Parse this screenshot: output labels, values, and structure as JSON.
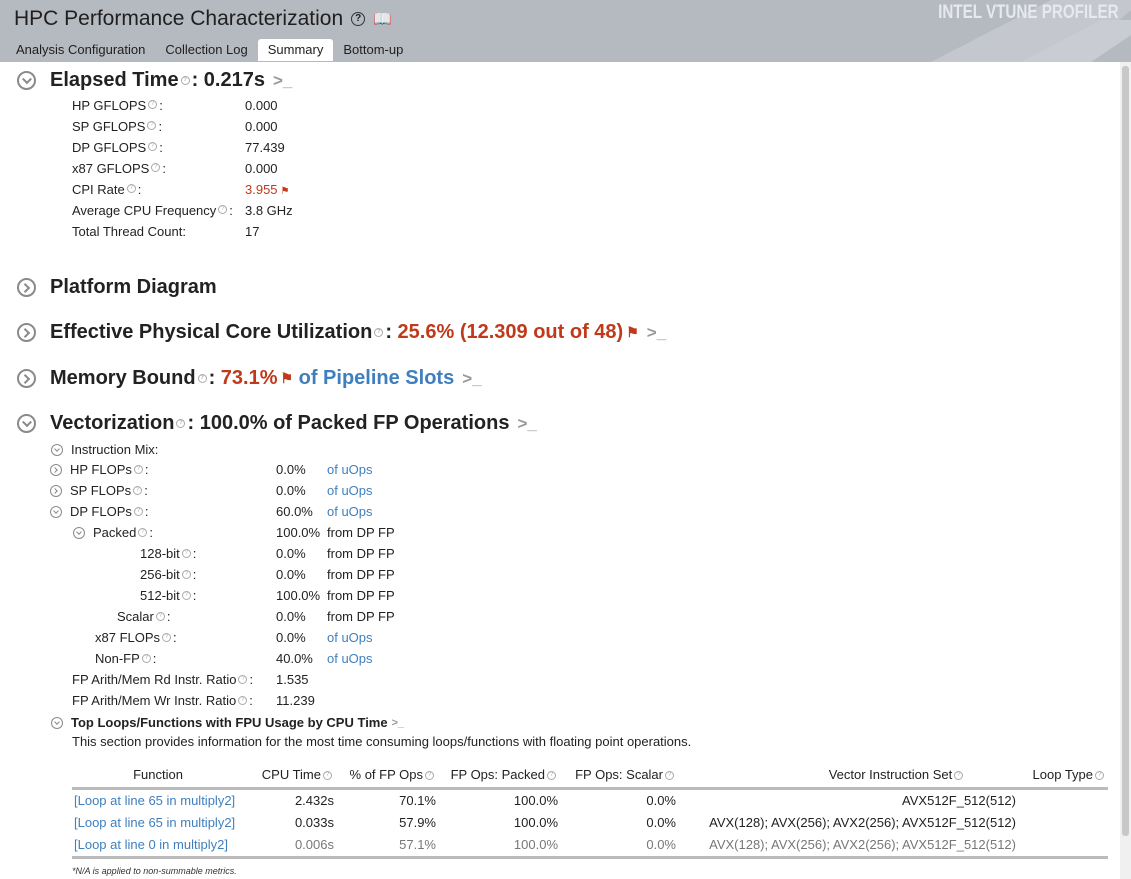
{
  "header": {
    "title": "HPC Performance Characterization",
    "brand": "INTEL VTUNE PROFILER",
    "tabs": [
      "Analysis Configuration",
      "Collection Log",
      "Summary",
      "Bottom-up"
    ]
  },
  "elapsed": {
    "label": "Elapsed Time",
    "value": ": 0.217s",
    "metrics": [
      {
        "label": "HP GFLOPS",
        "value": "0.000",
        "help": true
      },
      {
        "label": "SP GFLOPS",
        "value": "0.000",
        "help": true
      },
      {
        "label": "DP GFLOPS",
        "value": "77.439",
        "help": true
      },
      {
        "label": "x87 GFLOPS",
        "value": "0.000",
        "help": true
      },
      {
        "label": "CPI Rate",
        "value": "3.955",
        "help": true,
        "flag": true
      },
      {
        "label": "Average CPU Frequency",
        "value": "3.8 GHz",
        "help": true
      },
      {
        "label": "Total Thread Count:",
        "value": "17",
        "help": false
      }
    ]
  },
  "platform": {
    "label": "Platform Diagram"
  },
  "core_util": {
    "label": "Effective Physical Core Utilization",
    "value": "25.6% (12.309 out of 48)"
  },
  "memory": {
    "label": "Memory Bound",
    "value": "73.1%",
    "unit": "of Pipeline Slots"
  },
  "vector": {
    "label": "Vectorization",
    "value": ": 100.0% of Packed FP Operations",
    "mix_label": "Instruction Mix:",
    "mix": [
      {
        "label": "HP FLOPs",
        "value": "0.0%",
        "unit": "of uOps",
        "indent": 1,
        "toggle": "right"
      },
      {
        "label": "SP FLOPs",
        "value": "0.0%",
        "unit": "of uOps",
        "indent": 1,
        "toggle": "right"
      },
      {
        "label": "DP FLOPs",
        "value": "60.0%",
        "unit": "of uOps",
        "indent": 1,
        "toggle": "down"
      },
      {
        "label": "Packed",
        "value": "100.0%",
        "unit": "from DP FP",
        "indent": 2,
        "toggle": "down"
      },
      {
        "label": "128-bit",
        "value": "0.0%",
        "unit": "from DP FP",
        "indent": 3
      },
      {
        "label": "256-bit",
        "value": "0.0%",
        "unit": "from DP FP",
        "indent": 3
      },
      {
        "label": "512-bit",
        "value": "100.0%",
        "unit": "from DP FP",
        "indent": 3
      },
      {
        "label": "Scalar",
        "value": "0.0%",
        "unit": "from DP FP",
        "indent": 2
      },
      {
        "label": "x87 FLOPs",
        "value": "0.0%",
        "unit": "of uOps",
        "indent": 1
      },
      {
        "label": "Non-FP",
        "value": "40.0%",
        "unit": "of uOps",
        "indent": 1
      },
      {
        "label": "FP Arith/Mem Rd Instr. Ratio",
        "value": "1.535",
        "indent": 0
      },
      {
        "label": "FP Arith/Mem Wr Instr. Ratio",
        "value": "11.239",
        "indent": 0
      }
    ],
    "top_label": "Top Loops/Functions with FPU Usage by CPU Time",
    "top_desc": "This section provides information for the most time consuming loops/functions with floating point operations."
  },
  "table": {
    "columns": [
      "Function",
      "CPU Time",
      "% of FP Ops",
      "FP Ops: Packed",
      "FP Ops: Scalar",
      "Vector Instruction Set",
      "Loop Type"
    ],
    "rows": [
      [
        "[Loop at line 65 in multiply2]",
        "2.432s",
        "70.1%",
        "100.0%",
        "0.0%",
        "AVX512F_512(512)",
        ""
      ],
      [
        "[Loop at line 65 in multiply2]",
        "0.033s",
        "57.9%",
        "100.0%",
        "0.0%",
        "AVX(128); AVX(256); AVX2(256); AVX512F_512(512)",
        ""
      ],
      [
        "[Loop at line 0 in multiply2]",
        "0.006s",
        "57.1%",
        "100.0%",
        "0.0%",
        "AVX(128); AVX(256); AVX2(256); AVX512F_512(512)",
        ""
      ]
    ]
  },
  "footnote": "*N/A is applied to non-summable metrics."
}
